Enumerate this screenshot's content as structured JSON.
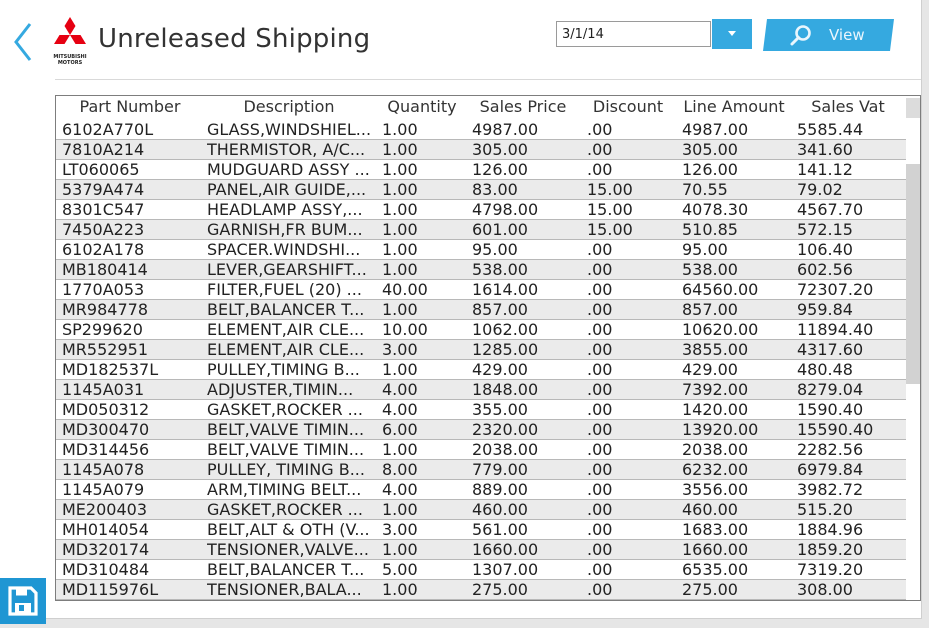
{
  "header": {
    "title": "Unreleased Shipping",
    "logo_text": "MITSUBISHI\nMOTORS",
    "back_icon": "chevron-left-icon",
    "brand_color": "#e60012",
    "accent_color": "#35a9e0"
  },
  "filter": {
    "date_value": "3/1/14",
    "dropdown_icon": "caret-down-icon",
    "view_label": "View",
    "view_icon": "search-icon"
  },
  "footer": {
    "save_icon": "floppy-disk-icon"
  },
  "table": {
    "columns": [
      "Part Number",
      "Description",
      "Quantity",
      "Sales Price",
      "Discount",
      "Line Amount",
      "Sales Vat"
    ],
    "rows": [
      [
        "6102A770L",
        "GLASS,WINDSHIEL...",
        "1.00",
        "4987.00",
        ".00",
        "4987.00",
        "5585.44"
      ],
      [
        "7810A214",
        "THERMISTOR, A/C...",
        "1.00",
        "305.00",
        ".00",
        "305.00",
        "341.60"
      ],
      [
        "LT060065",
        "MUDGUARD ASSY ...",
        "1.00",
        "126.00",
        ".00",
        "126.00",
        "141.12"
      ],
      [
        "5379A474",
        "PANEL,AIR GUIDE,...",
        "1.00",
        "83.00",
        "15.00",
        "70.55",
        "79.02"
      ],
      [
        "8301C547",
        "HEADLAMP ASSY,...",
        "1.00",
        "4798.00",
        "15.00",
        "4078.30",
        "4567.70"
      ],
      [
        "7450A223",
        "GARNISH,FR BUM...",
        "1.00",
        "601.00",
        "15.00",
        "510.85",
        "572.15"
      ],
      [
        "6102A178",
        "SPACER.WINDSHI...",
        "1.00",
        "95.00",
        ".00",
        "95.00",
        "106.40"
      ],
      [
        "MB180414",
        "LEVER,GEARSHIFT...",
        "1.00",
        "538.00",
        ".00",
        "538.00",
        "602.56"
      ],
      [
        "1770A053",
        "FILTER,FUEL (20)   ...",
        "40.00",
        "1614.00",
        ".00",
        "64560.00",
        "72307.20"
      ],
      [
        "MR984778",
        "BELT,BALANCER T...",
        "1.00",
        "857.00",
        ".00",
        "857.00",
        "959.84"
      ],
      [
        "SP299620",
        "ELEMENT,AIR CLE...",
        "10.00",
        "1062.00",
        ".00",
        "10620.00",
        "11894.40"
      ],
      [
        "MR552951",
        "ELEMENT,AIR CLE...",
        "3.00",
        "1285.00",
        ".00",
        "3855.00",
        "4317.60"
      ],
      [
        "MD182537L",
        "PULLEY,TIMING B...",
        "1.00",
        "429.00",
        ".00",
        "429.00",
        "480.48"
      ],
      [
        "1145A031",
        "ADJUSTER,TIMIN...",
        "4.00",
        "1848.00",
        ".00",
        "7392.00",
        "8279.04"
      ],
      [
        "MD050312",
        "GASKET,ROCKER ...",
        "4.00",
        "355.00",
        ".00",
        "1420.00",
        "1590.40"
      ],
      [
        "MD300470",
        "BELT,VALVE TIMIN...",
        "6.00",
        "2320.00",
        ".00",
        "13920.00",
        "15590.40"
      ],
      [
        "MD314456",
        "BELT,VALVE TIMIN...",
        "1.00",
        "2038.00",
        ".00",
        "2038.00",
        "2282.56"
      ],
      [
        "1145A078",
        "PULLEY, TIMING B...",
        "8.00",
        "779.00",
        ".00",
        "6232.00",
        "6979.84"
      ],
      [
        "1145A079",
        "ARM,TIMING BELT...",
        "4.00",
        "889.00",
        ".00",
        "3556.00",
        "3982.72"
      ],
      [
        "ME200403",
        "GASKET,ROCKER ...",
        "1.00",
        "460.00",
        ".00",
        "460.00",
        "515.20"
      ],
      [
        "MH014054",
        "BELT,ALT & OTH (V...",
        "3.00",
        "561.00",
        ".00",
        "1683.00",
        "1884.96"
      ],
      [
        "MD320174",
        "TENSIONER,VALVE...",
        "1.00",
        "1660.00",
        ".00",
        "1660.00",
        "1859.20"
      ],
      [
        "MD310484",
        "BELT,BALANCER T...",
        "5.00",
        "1307.00",
        ".00",
        "6535.00",
        "7319.20"
      ],
      [
        "MD115976L",
        "TENSIONER,BALA...",
        "1.00",
        "275.00",
        ".00",
        "275.00",
        "308.00"
      ]
    ]
  }
}
